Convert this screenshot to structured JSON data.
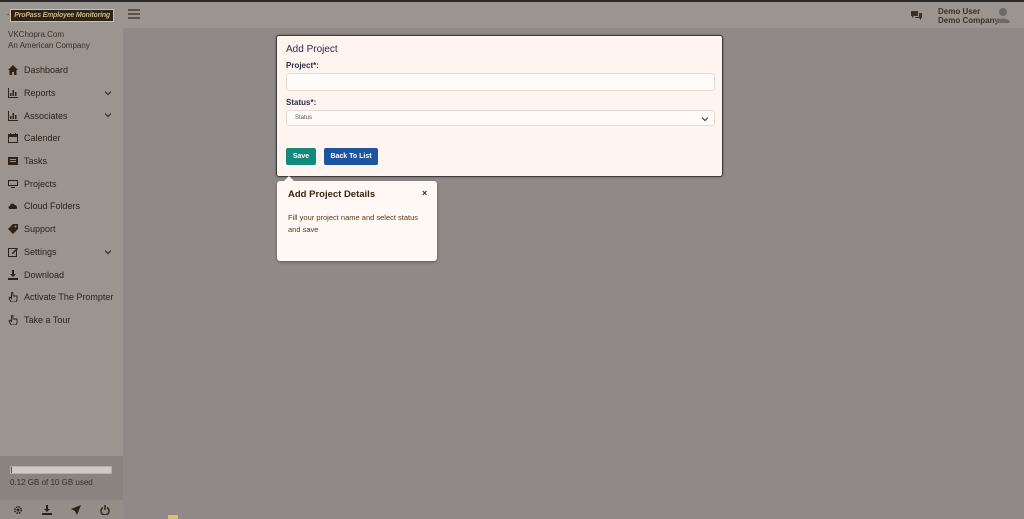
{
  "header": {
    "logo_text": "ProPass Employee Monitoring",
    "user_name": "Demo User",
    "user_company": "Demo Company"
  },
  "sidebar": {
    "company_name": "VKChopra.Com",
    "company_tagline": "An American Company",
    "items": [
      {
        "label": "Dashboard",
        "icon": "home-icon"
      },
      {
        "label": "Reports",
        "icon": "bar-chart-icon",
        "has_submenu": true
      },
      {
        "label": "Associates",
        "icon": "bar-chart-icon",
        "has_submenu": true
      },
      {
        "label": "Calender",
        "icon": "calendar-icon"
      },
      {
        "label": "Tasks",
        "icon": "tasks-icon"
      },
      {
        "label": "Projects",
        "icon": "desktop-icon"
      },
      {
        "label": "Cloud Folders",
        "icon": "cloud-icon"
      },
      {
        "label": "Support",
        "icon": "tag-icon"
      },
      {
        "label": "Settings",
        "icon": "edit-icon",
        "has_submenu": true
      },
      {
        "label": "Download",
        "icon": "download-icon"
      },
      {
        "label": "Activate The Prompter",
        "icon": "hand-icon"
      },
      {
        "label": "Take a Tour",
        "icon": "hand-icon"
      }
    ],
    "storage_text": "0.12 GB of 10 GB used",
    "storage_fraction": 0.012,
    "footer_icons": [
      "gear-icon",
      "download-icon",
      "send-icon",
      "power-icon"
    ]
  },
  "form": {
    "title": "Add Project",
    "project_label": "Project*:",
    "project_value": "",
    "status_label": "Status*:",
    "status_value": "Status",
    "save_label": "Save",
    "back_label": "Back To List"
  },
  "tour": {
    "title": "Add Project Details",
    "close_symbol": "×",
    "body": "Fill your project name and select status and save"
  },
  "colors": {
    "overlay": "#8f8a87",
    "save_button": "#12897a",
    "back_button": "#1b55a0",
    "storage_fill": "#2d5f9a"
  }
}
